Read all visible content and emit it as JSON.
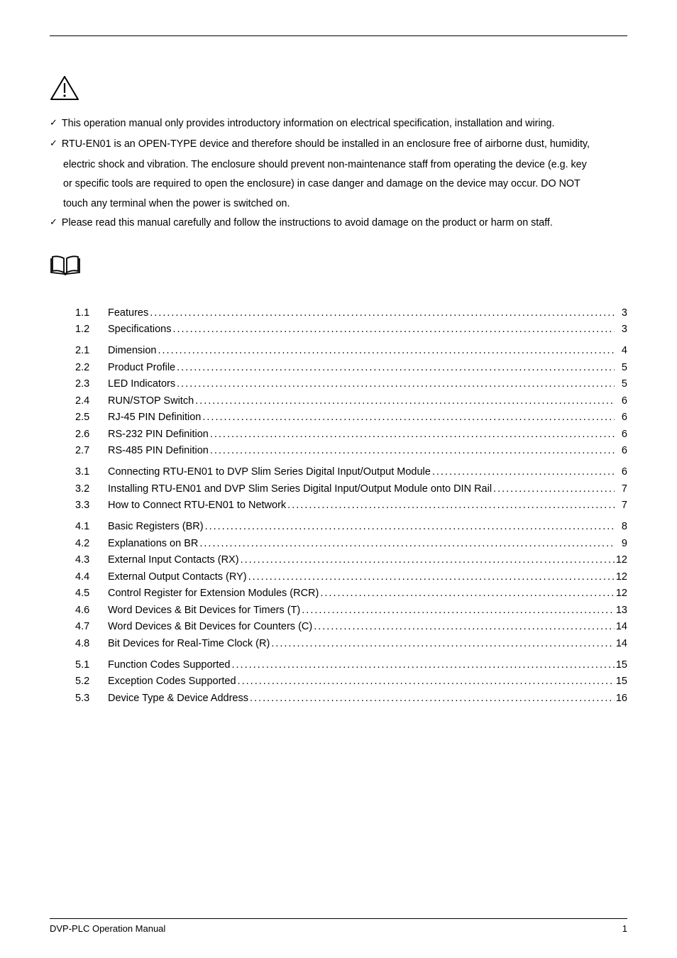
{
  "notes": {
    "n1": "This operation manual only provides introductory information on electrical specification, installation and wiring.",
    "n2a": "RTU-EN01 is an OPEN-TYPE device and therefore should be installed in an enclosure free of airborne dust, humidity,",
    "n2b": "electric shock and vibration. The enclosure should prevent non-maintenance staff from operating the device (e.g. key",
    "n2c": "or specific tools are required to open the enclosure) in case danger and damage on the device may occur. DO NOT",
    "n2d": "touch any terminal when the power is switched on.",
    "n3": "Please read this manual carefully and follow the instructions to avoid damage on the product or harm on staff."
  },
  "toc": {
    "g1": [
      {
        "num": "1.1",
        "title": "Features",
        "page": "3"
      },
      {
        "num": "1.2",
        "title": "Specifications",
        "page": "3"
      }
    ],
    "g2": [
      {
        "num": "2.1",
        "title": "Dimension",
        "page": "4"
      },
      {
        "num": "2.2",
        "title": "Product Profile",
        "page": "5"
      },
      {
        "num": "2.3",
        "title": "LED Indicators",
        "page": "5"
      },
      {
        "num": "2.4",
        "title": "RUN/STOP Switch",
        "page": "6"
      },
      {
        "num": "2.5",
        "title": "RJ-45 PIN Definition",
        "page": "6"
      },
      {
        "num": "2.6",
        "title": "RS-232 PIN Definition",
        "page": "6"
      },
      {
        "num": "2.7",
        "title": "RS-485 PIN Definition",
        "page": "6"
      }
    ],
    "g3": [
      {
        "num": "3.1",
        "title": "Connecting RTU-EN01 to DVP Slim Series Digital Input/Output Module",
        "page": "6"
      },
      {
        "num": "3.2",
        "title": "Installing RTU-EN01 and DVP Slim Series Digital Input/Output Module onto DIN Rail",
        "page": "7"
      },
      {
        "num": "3.3",
        "title": "How to Connect RTU-EN01 to Network",
        "page": "7"
      }
    ],
    "g4": [
      {
        "num": "4.1",
        "title": "Basic Registers (BR)",
        "page": "8"
      },
      {
        "num": "4.2",
        "title": "Explanations on BR",
        "page": "9"
      },
      {
        "num": "4.3",
        "title": "External Input Contacts (RX)",
        "page": "12"
      },
      {
        "num": "4.4",
        "title": "External Output Contacts (RY)",
        "page": "12"
      },
      {
        "num": "4.5",
        "title": "Control Register for Extension Modules (RCR)",
        "page": "12"
      },
      {
        "num": "4.6",
        "title": "Word Devices & Bit Devices for Timers (T)",
        "page": "13"
      },
      {
        "num": "4.7",
        "title": "Word Devices & Bit Devices for Counters (C)",
        "page": "14"
      },
      {
        "num": "4.8",
        "title": "Bit Devices for Real-Time Clock (R)",
        "page": "14"
      }
    ],
    "g5": [
      {
        "num": "5.1",
        "title": "Function Codes Supported",
        "page": "15"
      },
      {
        "num": "5.2",
        "title": "Exception Codes Supported",
        "page": "15"
      },
      {
        "num": "5.3",
        "title": "Device Type & Device Address",
        "page": "16"
      }
    ]
  },
  "footer": {
    "left": "DVP-PLC Operation Manual",
    "right": "1"
  }
}
